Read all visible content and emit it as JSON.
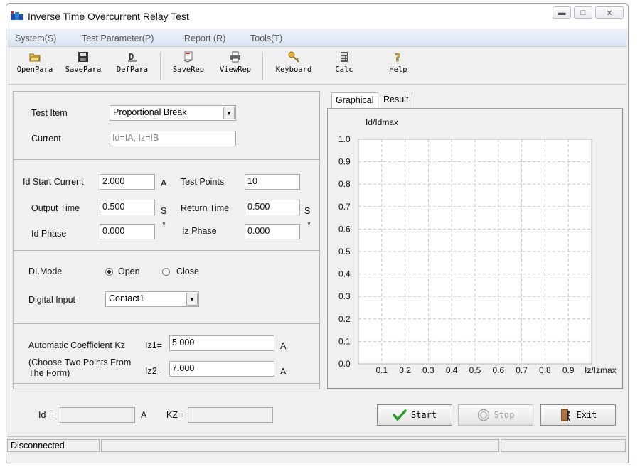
{
  "window": {
    "title": "Inverse Time Overcurrent Relay Test"
  },
  "menu": [
    "System(S)",
    "Test Parameter(P)",
    "Report (R)",
    "Tools(T)"
  ],
  "toolbar": [
    "OpenPara",
    "SavePara",
    "DefPara",
    "SaveRep",
    "ViewRep",
    "Keyboard",
    "Calc",
    "Help"
  ],
  "form": {
    "test_item_label": "Test Item",
    "test_item_value": "Proportional Break",
    "current_label": "Current",
    "current_value": "Id=IA, Iz=IB",
    "id_start_label": "Id Start Current",
    "id_start_value": "2.000",
    "id_start_unit": "A",
    "test_points_label": "Test Points",
    "test_points_value": "10",
    "output_time_label": "Output Time",
    "output_time_value": "0.500",
    "output_time_unit": "S",
    "return_time_label": "Return Time",
    "return_time_value": "0.500",
    "return_time_unit": "S",
    "id_phase_label": "Id Phase",
    "id_phase_value": "0.000",
    "id_phase_unit": "°",
    "iz_phase_label": "Iz Phase",
    "iz_phase_value": "0.000",
    "iz_phase_unit": "°",
    "di_mode_label": "DI.Mode",
    "di_open": "Open",
    "di_close": "Close",
    "digital_input_label": "Digital Input",
    "digital_input_value": "Contact1",
    "kz_label": "Automatic Coefficient Kz",
    "kz_note": "(Choose Two Points From The Form)",
    "iz1_label": "Iz1=",
    "iz1_value": "5.000",
    "iz1_unit": "A",
    "iz2_label": "Iz2=",
    "iz2_value": "7.000",
    "iz2_unit": "A",
    "id_result_label": "Id =",
    "id_result_value": "",
    "id_result_unit": "A",
    "kz_result_label": "KZ=",
    "kz_result_value": ""
  },
  "tabs": [
    "Graphical",
    "Result"
  ],
  "chart_data": {
    "type": "line",
    "ylabel": "Id/Idmax",
    "xlabel": "Iz/Izmax",
    "xticks": [
      "0.1",
      "0.2",
      "0.3",
      "0.4",
      "0.5",
      "0.6",
      "0.7",
      "0.8",
      "0.9"
    ],
    "yticks": [
      "0.0",
      "0.1",
      "0.2",
      "0.3",
      "0.4",
      "0.5",
      "0.6",
      "0.7",
      "0.8",
      "0.9",
      "1.0"
    ],
    "xlim": [
      0,
      1
    ],
    "ylim": [
      0,
      1
    ],
    "grid": true,
    "series": []
  },
  "buttons": {
    "start": "Start",
    "stop": "Stop",
    "exit": "Exit"
  },
  "status": {
    "connection": "Disconnected"
  },
  "colors": {
    "menubar": "#d8e3f3",
    "grid": "#c8c8c8",
    "start_check": "#2a9a2a"
  }
}
